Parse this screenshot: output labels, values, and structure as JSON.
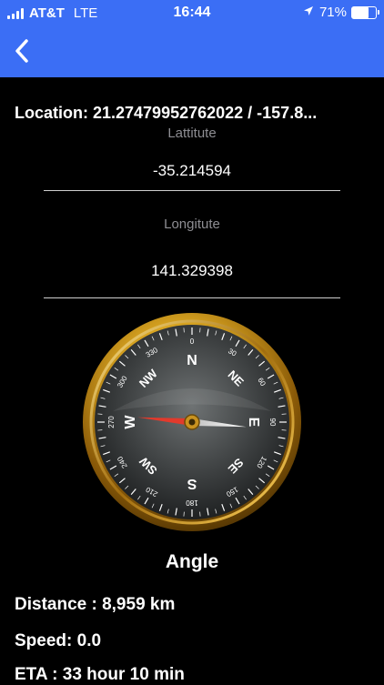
{
  "status_bar": {
    "carrier": "AT&T",
    "network": "LTE",
    "time": "16:44",
    "battery": "71%",
    "battery_level": 0.71,
    "icons": [
      "signal-bars-icon",
      "location-arrow-icon",
      "battery-icon"
    ]
  },
  "nav": {
    "back_icon": "chevron-left-icon"
  },
  "location_text": "Location: 21.27479952762022 / -157.8...",
  "latitude": {
    "label": "Lattitute",
    "value": "-35.214594"
  },
  "longitude": {
    "label": "Longitute",
    "value": "141.329398"
  },
  "compass": {
    "directions": {
      "n": "N",
      "ne": "NE",
      "e": "E",
      "se": "SE",
      "s": "S",
      "sw": "SW",
      "w": "W",
      "nw": "NW"
    },
    "degree_ticks": [
      "0",
      "30",
      "60",
      "90",
      "120",
      "150",
      "180",
      "210",
      "240",
      "270",
      "300",
      "330"
    ],
    "needle_bearing_deg": 95
  },
  "angle_label": "Angle",
  "distance": "Distance : 8,959 km",
  "speed": "Speed: 0.0",
  "eta": "ETA : 33 hour 10 min",
  "colors": {
    "accent": "#3b6ef5",
    "background": "#000000",
    "label_gray": "#8e8e93",
    "needle_red": "#e23a2c"
  }
}
